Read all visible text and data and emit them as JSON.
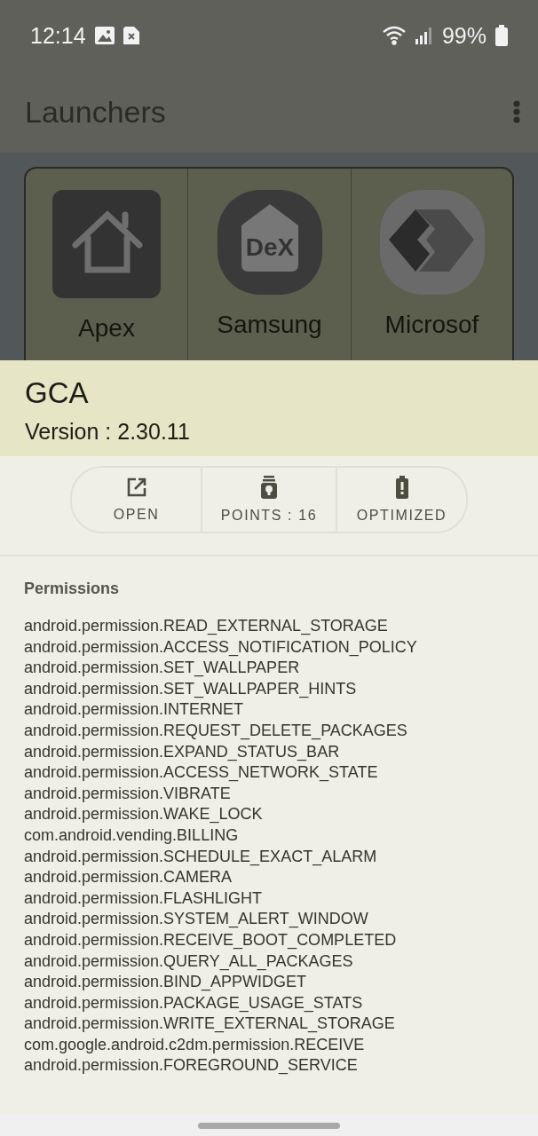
{
  "status_bar": {
    "time": "12:14",
    "battery": "99%"
  },
  "app_bar": {
    "title": "Launchers"
  },
  "launchers": [
    {
      "label": "Apex",
      "kind": "house"
    },
    {
      "label": "Samsung",
      "kind": "dex",
      "icon_text": "DeX"
    },
    {
      "label": "Microsof",
      "kind": "chevron"
    }
  ],
  "sheet": {
    "app_name": "GCA",
    "version": "Version : 2.30.11",
    "actions": [
      {
        "label": "OPEN",
        "kind": "open"
      },
      {
        "label": "POINTS : 16",
        "kind": "points"
      },
      {
        "label": "OPTIMIZED",
        "kind": "battery"
      }
    ],
    "permissions_title": "Permissions",
    "permissions": [
      "android.permission.READ_EXTERNAL_STORAGE",
      "android.permission.ACCESS_NOTIFICATION_POLICY",
      "android.permission.SET_WALLPAPER",
      "android.permission.SET_WALLPAPER_HINTS",
      "android.permission.INTERNET",
      "android.permission.REQUEST_DELETE_PACKAGES",
      "android.permission.EXPAND_STATUS_BAR",
      "android.permission.ACCESS_NETWORK_STATE",
      "android.permission.VIBRATE",
      "android.permission.WAKE_LOCK",
      "com.android.vending.BILLING",
      "android.permission.SCHEDULE_EXACT_ALARM",
      "android.permission.CAMERA",
      "android.permission.FLASHLIGHT",
      "android.permission.SYSTEM_ALERT_WINDOW",
      "android.permission.RECEIVE_BOOT_COMPLETED",
      "android.permission.QUERY_ALL_PACKAGES",
      "android.permission.BIND_APPWIDGET",
      "android.permission.PACKAGE_USAGE_STATS",
      "android.permission.WRITE_EXTERNAL_STORAGE",
      "com.google.android.c2dm.permission.RECEIVE",
      "android.permission.FOREGROUND_SERVICE"
    ]
  }
}
